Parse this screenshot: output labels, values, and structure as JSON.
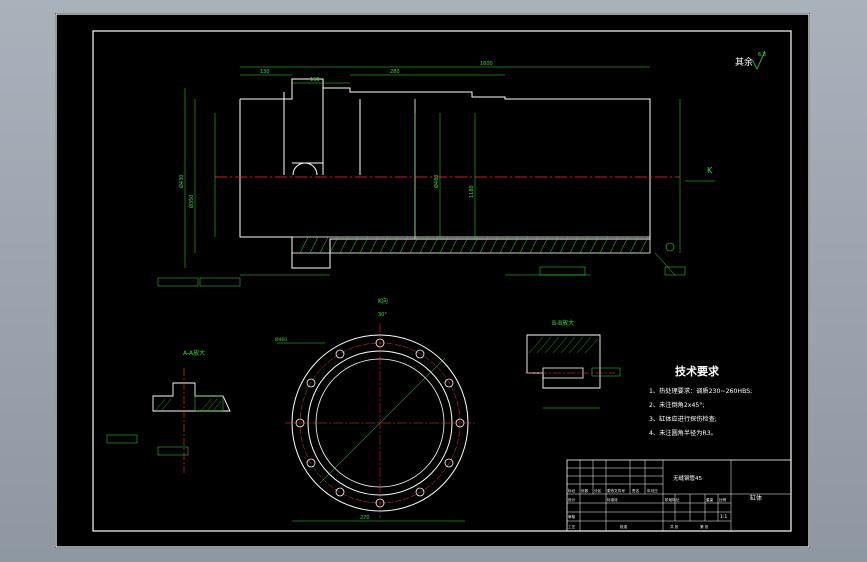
{
  "surface_finish_note": "其余",
  "surface_finish_value": "6.3",
  "tech_requirements": {
    "title": "技术要求",
    "items": [
      "1、热处理要求：调质230~260HBS;",
      "2、未注倒角2x45°;",
      "3、缸体应进行探伤检查;",
      "4、未注圆角半径为R3。"
    ]
  },
  "section_labels": {
    "detail_a": "A-A放大",
    "detail_b": "B-B放大",
    "view_k": "K向",
    "k_marker": "K"
  },
  "title_block": {
    "material": "无缝钢管45",
    "part_name": "缸体",
    "scale": "1:1",
    "row_headers": [
      "标记",
      "处数",
      "分区",
      "更改文件号",
      "签名",
      "年月日"
    ],
    "labels": [
      "设计",
      "标准化",
      "阶段标记",
      "重量",
      "比例",
      "审核",
      "工艺",
      "批准",
      "共 张",
      "第 张"
    ]
  },
  "dimensions": {
    "total_length": "1600",
    "section_a_length": "130",
    "section_b_length": "280",
    "flange_length": "160",
    "dia_outer": "Ø430",
    "dia_bore": "Ø350",
    "dia_flange": "Ø480",
    "bore_length": "1180",
    "bolt_circle": "Ø460",
    "view_k_width": "270",
    "angle": "30°"
  },
  "colors": {
    "drawing_bg": "#000000",
    "outline": "#ffffff",
    "dimension": "#22dd22",
    "centerline": "#ff3030",
    "frame": "#ffffff"
  }
}
